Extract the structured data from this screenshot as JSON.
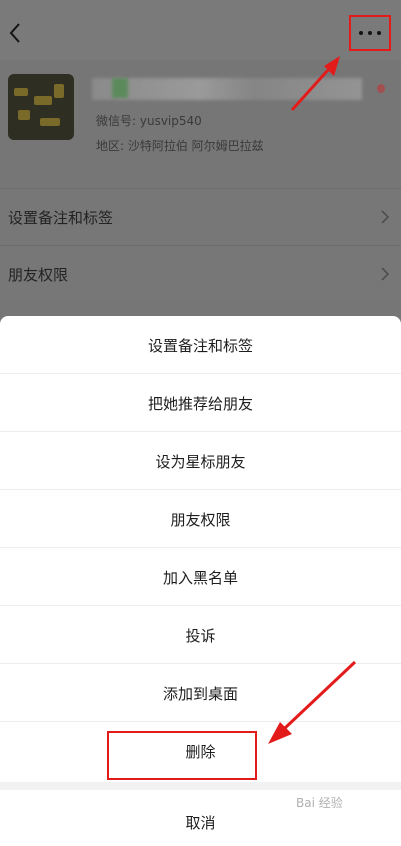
{
  "header": {
    "back_icon": "chevron-left-icon",
    "more_icon": "more-dots-icon"
  },
  "profile": {
    "wechat_id": "微信号: yusvip540",
    "region": "地区: 沙特阿拉伯  阿尔姆巴拉兹"
  },
  "background_rows": [
    {
      "label": "设置备注和标签"
    },
    {
      "label": "朋友权限"
    }
  ],
  "action_sheet": {
    "items": [
      {
        "label": "设置备注和标签"
      },
      {
        "label": "把她推荐给朋友"
      },
      {
        "label": "设为星标朋友"
      },
      {
        "label": "朋友权限"
      },
      {
        "label": "加入黑名单"
      },
      {
        "label": "投诉"
      },
      {
        "label": "添加到桌面"
      },
      {
        "label": "删除"
      }
    ],
    "cancel_label": "取消"
  },
  "annotation_color": "#e31b1b",
  "watermark": "Bai 经验"
}
